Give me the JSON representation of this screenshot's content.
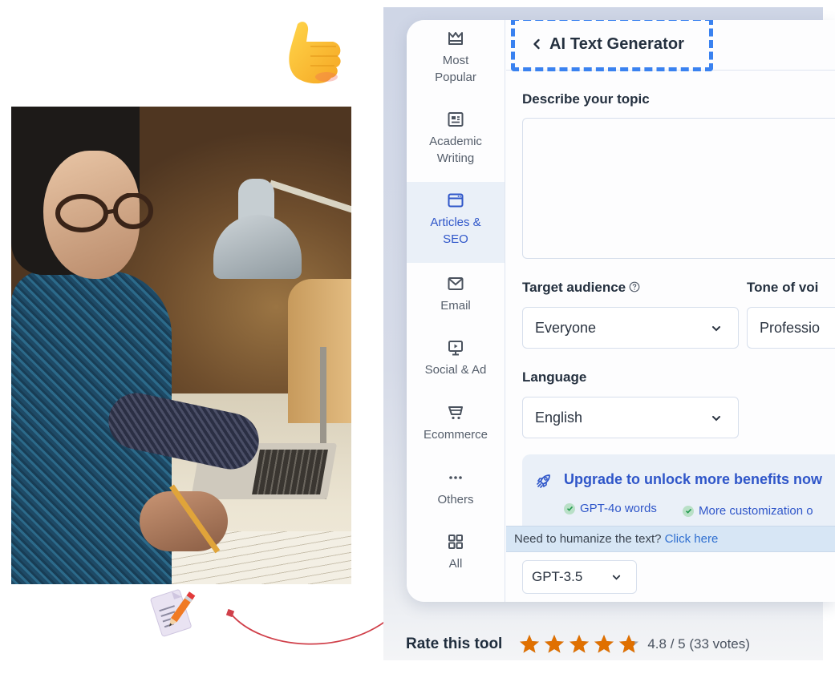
{
  "sidebar": {
    "items": [
      {
        "label": "Most\nPopular",
        "icon": "crown-icon",
        "active": false
      },
      {
        "label": "Academic\nWriting",
        "icon": "id-card-icon",
        "active": false
      },
      {
        "label": "Articles &\nSEO",
        "icon": "browser-window-icon",
        "active": true
      },
      {
        "label": "Email",
        "icon": "envelope-icon",
        "active": false
      },
      {
        "label": "Social & Ad",
        "icon": "presentation-play-icon",
        "active": false
      },
      {
        "label": "Ecommerce",
        "icon": "shopping-cart-icon",
        "active": false
      },
      {
        "label": "Others",
        "icon": "more-dots-icon",
        "active": false
      },
      {
        "label": "All",
        "icon": "grid-icon",
        "active": false
      }
    ]
  },
  "header": {
    "back_icon": "chevron-left-icon",
    "title": "AI Text Generator"
  },
  "form": {
    "topic_label": "Describe your topic",
    "topic_value": "",
    "audience_label": "Target audience",
    "audience_value": "Everyone",
    "tone_label": "Tone of voi",
    "tone_value": "Professio",
    "language_label": "Language",
    "language_value": "English"
  },
  "upgrade": {
    "title": "Upgrade to unlock more benefits now",
    "benefits": [
      "GPT-4o words",
      "More customization o"
    ]
  },
  "humanize": {
    "text": "Need to humanize the text?",
    "link": "Click here"
  },
  "model": {
    "value": "GPT-3.5"
  },
  "rating": {
    "label": "Rate this tool",
    "score": 4.8,
    "max": 5,
    "text": "4.8 / 5 (33 votes)",
    "star_color": "#e07000"
  },
  "colors": {
    "accent": "#2f56c9",
    "highlight_dash": "#3a82f0",
    "active_bg": "#eaf0f8",
    "arrow": "#d0404a"
  }
}
